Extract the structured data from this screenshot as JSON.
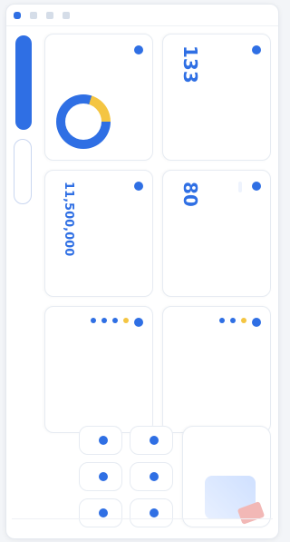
{
  "toolbar": {
    "items": [
      "menu",
      "home",
      "apps",
      "more"
    ]
  },
  "cards": [
    {
      "id": "c1",
      "title": "",
      "subtitle": "",
      "value": "133"
    },
    {
      "id": "c2",
      "title": "",
      "subtitle": "",
      "value": "80",
      "pill": ""
    },
    {
      "id": "c3",
      "title": "",
      "subtitle": "",
      "list": []
    },
    {
      "id": "c4",
      "title": "",
      "subtitle": "",
      "donut_value": "",
      "legend": []
    },
    {
      "id": "c5",
      "title": "",
      "subtitle": "",
      "value": "11,500,000"
    },
    {
      "id": "c6",
      "title": "",
      "subtitle": "",
      "list": []
    }
  ],
  "hero": {
    "text_lines": [],
    "link": ""
  },
  "quick_actions": [
    {
      "label": ""
    },
    {
      "label": ""
    },
    {
      "label": ""
    },
    {
      "label": ""
    },
    {
      "label": ""
    },
    {
      "label": ""
    }
  ],
  "buttons": {
    "primary": "",
    "secondary": ""
  },
  "colors": {
    "accent": "#2f6fe4",
    "yellow": "#f4c542",
    "hero_accent": "#f2b8b6"
  }
}
